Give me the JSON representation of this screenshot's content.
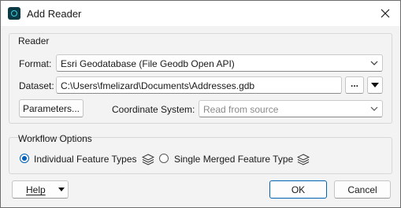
{
  "window": {
    "title": "Add Reader",
    "close_glyph": "✕"
  },
  "reader_group": {
    "title": "Reader",
    "format_label": "Format:",
    "format_value": "Esri Geodatabase (File Geodb Open API)",
    "dataset_label": "Dataset:",
    "dataset_value": "C:\\Users\\fmelizard\\Documents\\Addresses.gdb",
    "browse_label": "...",
    "parameters_label": "Parameters...",
    "coord_label": "Coordinate System:",
    "coord_placeholder": "Read from source"
  },
  "workflow_group": {
    "title": "Workflow Options",
    "options": [
      {
        "label": "Individual Feature Types",
        "selected": true
      },
      {
        "label": "Single Merged Feature Type",
        "selected": false
      }
    ]
  },
  "footer": {
    "help_label": "Help",
    "ok_label": "OK",
    "cancel_label": "Cancel"
  },
  "icons": {
    "app": "fme-app-icon",
    "close": "close-icon",
    "chevron": "chevron-down-icon",
    "dropdown": "triangle-down-icon",
    "layers": "layers-icon"
  },
  "colors": {
    "accent": "#005fb8",
    "app_icon_bg": "#0c3b46",
    "app_icon_ring": "#3fd0e0"
  }
}
